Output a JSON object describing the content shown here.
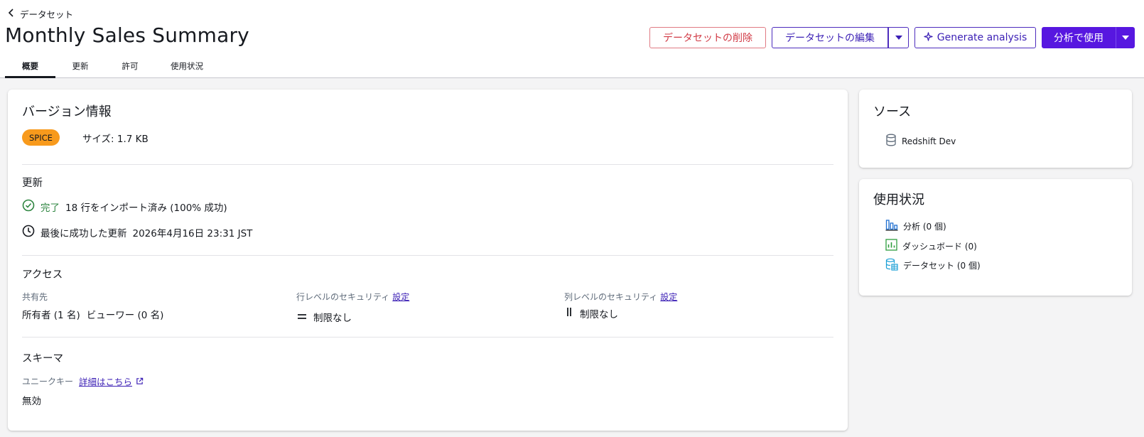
{
  "header": {
    "back_label": "データセット",
    "title": "Monthly Sales Summary",
    "buttons": {
      "delete": "データセットの削除",
      "edit": "データセットの編集",
      "generate": "Generate analysis",
      "use_in_analysis": "分析で使用"
    },
    "tabs": [
      {
        "label": "概要",
        "active": true
      },
      {
        "label": "更新",
        "active": false
      },
      {
        "label": "許可",
        "active": false
      },
      {
        "label": "使用状況",
        "active": false
      }
    ]
  },
  "version": {
    "heading": "バージョン情報",
    "badge": "SPICE",
    "size": "サイズ: 1.7 KB"
  },
  "refresh": {
    "heading": "更新",
    "status": "完了",
    "status_detail": "18 行をインポート済み (100% 成功)",
    "last_label": "最後に成功した更新",
    "last_value": "2026年4月16日 23:31 JST"
  },
  "access": {
    "heading": "アクセス",
    "shared_label": "共有先",
    "owners": "所有者 (1 名)",
    "viewers": "ビューワー (0 名)",
    "row_security_label": "行レベルのセキュリティ",
    "row_security_link": "設定",
    "row_security_value": "制限なし",
    "col_security_label": "列レベルのセキュリティ",
    "col_security_link": "設定",
    "col_security_value": "制限なし"
  },
  "schema": {
    "heading": "スキーマ",
    "unique_key_label": "ユニークキー",
    "learn_more": "詳細はこちら",
    "value": "無効"
  },
  "source": {
    "heading": "ソース",
    "name": "Redshift Dev"
  },
  "usage": {
    "heading": "使用状況",
    "items": [
      {
        "label": "分析 (0 個)",
        "icon": "analysis-icon"
      },
      {
        "label": "ダッシュボード (0)",
        "icon": "dashboard-icon"
      },
      {
        "label": "データセット (0 個)",
        "icon": "dataset-icon"
      }
    ]
  },
  "colors": {
    "primary": "#5717e0",
    "danger": "#d13a45",
    "success": "#2e8540",
    "spice_badge": "#f89a1c"
  }
}
